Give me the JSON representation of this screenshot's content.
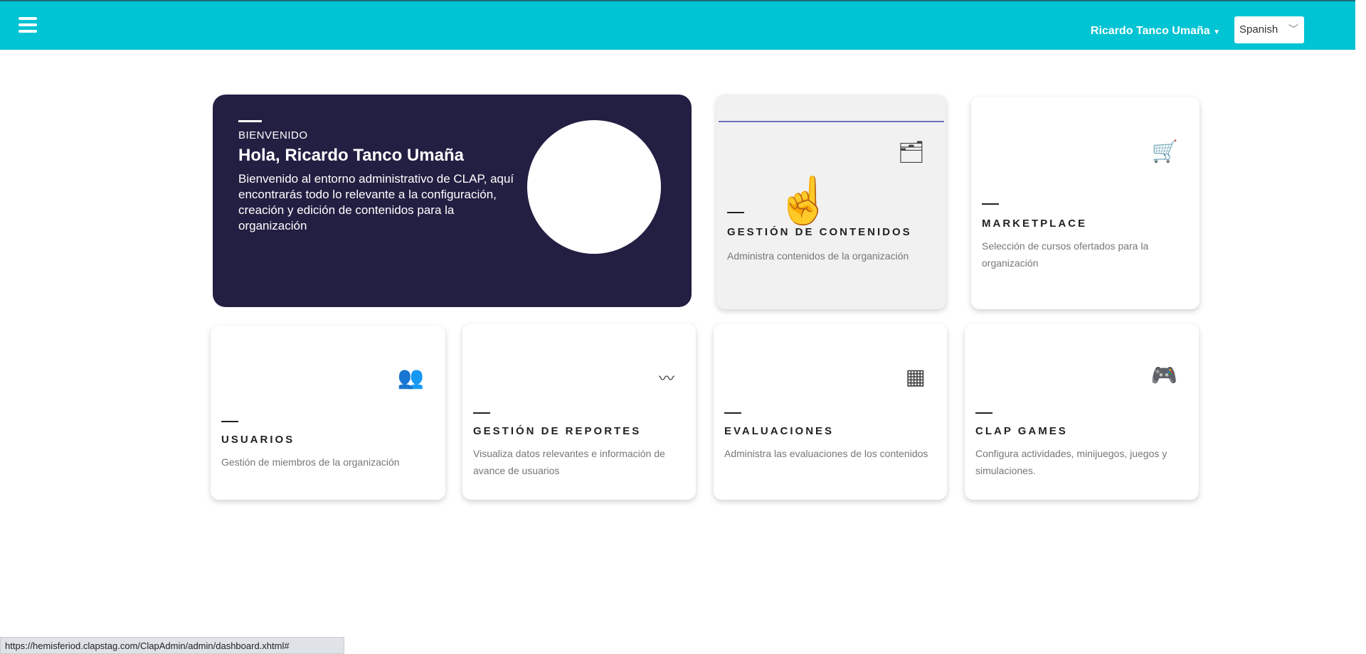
{
  "header": {
    "user_name": "Ricardo Tanco Umaña",
    "language": "Spanish",
    "colors": {
      "bar": "#00c3d3"
    }
  },
  "welcome": {
    "kicker": "BIENVENIDO",
    "greeting": "Hola, Ricardo Tanco Umaña",
    "message": "Bienvenido al entorno administrativo de CLAP, aquí encontrarás todo lo relevante a la configuración, creación y edición de contenidos para la organización",
    "bg": "#231f42"
  },
  "cards": [
    {
      "title": "GESTIÓN DE CONTENIDOS",
      "desc": "Administra contenidos de la organización",
      "icon": "folder-icon"
    },
    {
      "title": "MARKETPLACE",
      "desc": "Selección de cursos ofertados para la organización",
      "icon": "cart-icon"
    },
    {
      "title": "USUARIOS",
      "desc": "Gestión de miembros de la organización",
      "icon": "users-icon"
    },
    {
      "title": "GESTIÓN DE REPORTES",
      "desc": "Visualiza datos relevantes e información de avance de usuarios",
      "icon": "chart-icon"
    },
    {
      "title": "EVALUACIONES",
      "desc": "Administra las evaluaciones de los contenidos",
      "icon": "evaluation-icon"
    },
    {
      "title": "CLAP GAMES",
      "desc": "Configura actividades, minijuegos, juegos y simulaciones.",
      "icon": "gamepad-icon"
    }
  ],
  "status_url": "https://hemisferiod.clapstag.com/ClapAdmin/admin/dashboard.xhtml#"
}
